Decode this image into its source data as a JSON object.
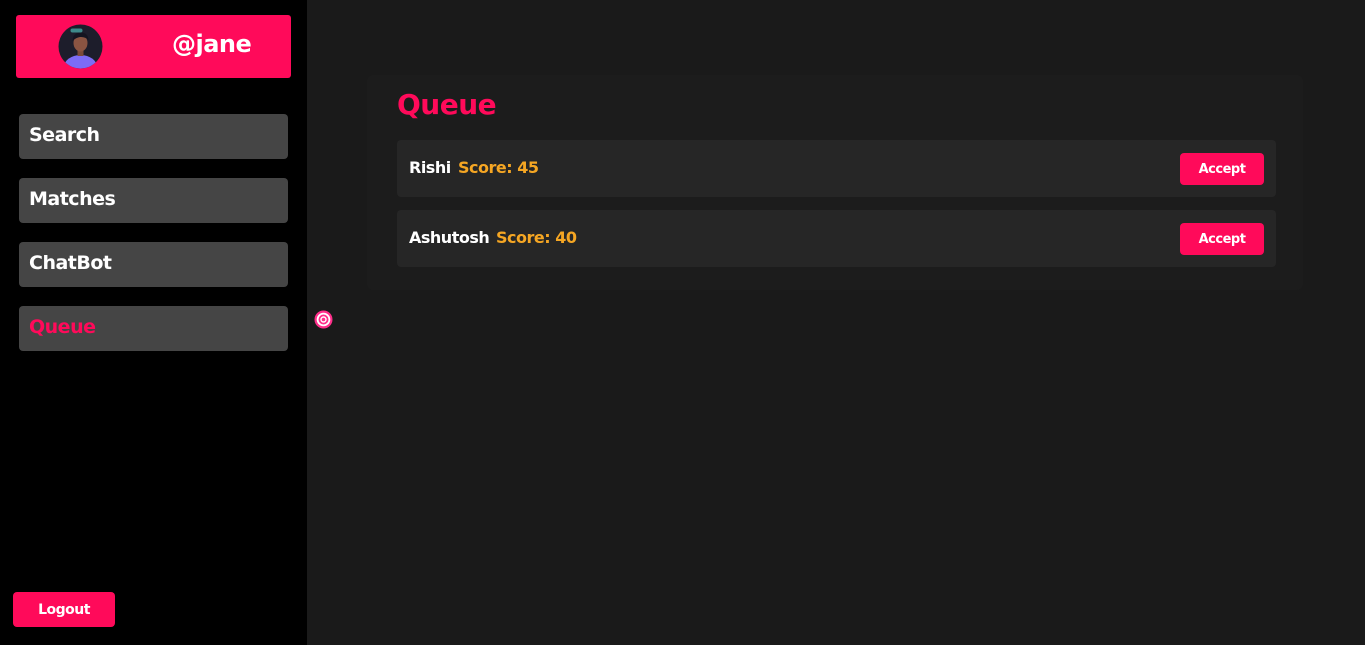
{
  "user": {
    "username": "@jane"
  },
  "sidebar": {
    "items": [
      {
        "label": "Search",
        "active": false
      },
      {
        "label": "Matches",
        "active": false
      },
      {
        "label": "ChatBot",
        "active": false
      },
      {
        "label": "Queue",
        "active": true
      }
    ],
    "logout_label": "Logout"
  },
  "main": {
    "title": "Queue",
    "queue": [
      {
        "name": "Rishi",
        "score": "Score: 45",
        "action_label": "Accept"
      },
      {
        "name": "Ashutosh",
        "score": "Score: 40",
        "action_label": "Accept"
      }
    ]
  },
  "colors": {
    "accent": "#ff0a5a",
    "score": "#f5a623",
    "sidebar_bg": "#000000",
    "main_bg": "#1a1a1a",
    "nav_item_bg": "#454545",
    "row_bg": "#262626"
  },
  "icons": {
    "avatar": "user-avatar-icon",
    "cursor": "target-cursor-icon"
  }
}
